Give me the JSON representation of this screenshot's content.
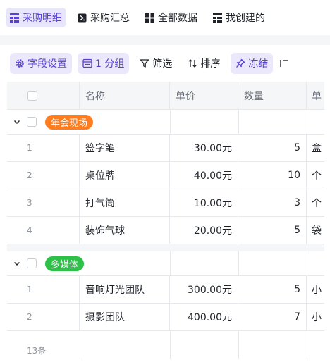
{
  "view_tabs": [
    {
      "label": "采购明细",
      "icon": "grid-view-icon",
      "active": true
    },
    {
      "label": "采购汇总",
      "icon": "summary-view-icon",
      "active": false
    },
    {
      "label": "全部数据",
      "icon": "four-squares-icon",
      "active": false
    },
    {
      "label": "我创建的",
      "icon": "grid-view-icon",
      "active": false
    }
  ],
  "toolbar": {
    "field_settings": "字段设置",
    "group": "1 分组",
    "filter": "筛选",
    "sort": "排序",
    "freeze": "冻结"
  },
  "table": {
    "columns": [
      "名称",
      "单价",
      "数量",
      "单"
    ],
    "groups": [
      {
        "name": "年会现场",
        "color": "#ff7d1f",
        "rows": [
          {
            "index": "1",
            "name": "签字笔",
            "price": "30.00元",
            "qty": "5",
            "unit": "盒"
          },
          {
            "index": "2",
            "name": "桌位牌",
            "price": "40.00元",
            "qty": "10",
            "unit": "个"
          },
          {
            "index": "3",
            "name": "打气筒",
            "price": "10.00元",
            "qty": "3",
            "unit": "个"
          },
          {
            "index": "4",
            "name": "装饰气球",
            "price": "20.00元",
            "qty": "5",
            "unit": "袋"
          }
        ]
      },
      {
        "name": "多媒体",
        "color": "#2ec048",
        "rows": [
          {
            "index": "1",
            "name": "音响灯光团队",
            "price": "300.00元",
            "qty": "5",
            "unit": "小"
          },
          {
            "index": "2",
            "name": "摄影团队",
            "price": "400.00元",
            "qty": "7",
            "unit": "小"
          }
        ]
      }
    ],
    "record_count": "13条"
  },
  "colors": {
    "accent": "#5a3fd6",
    "accent_bg": "#ebe8fb"
  }
}
